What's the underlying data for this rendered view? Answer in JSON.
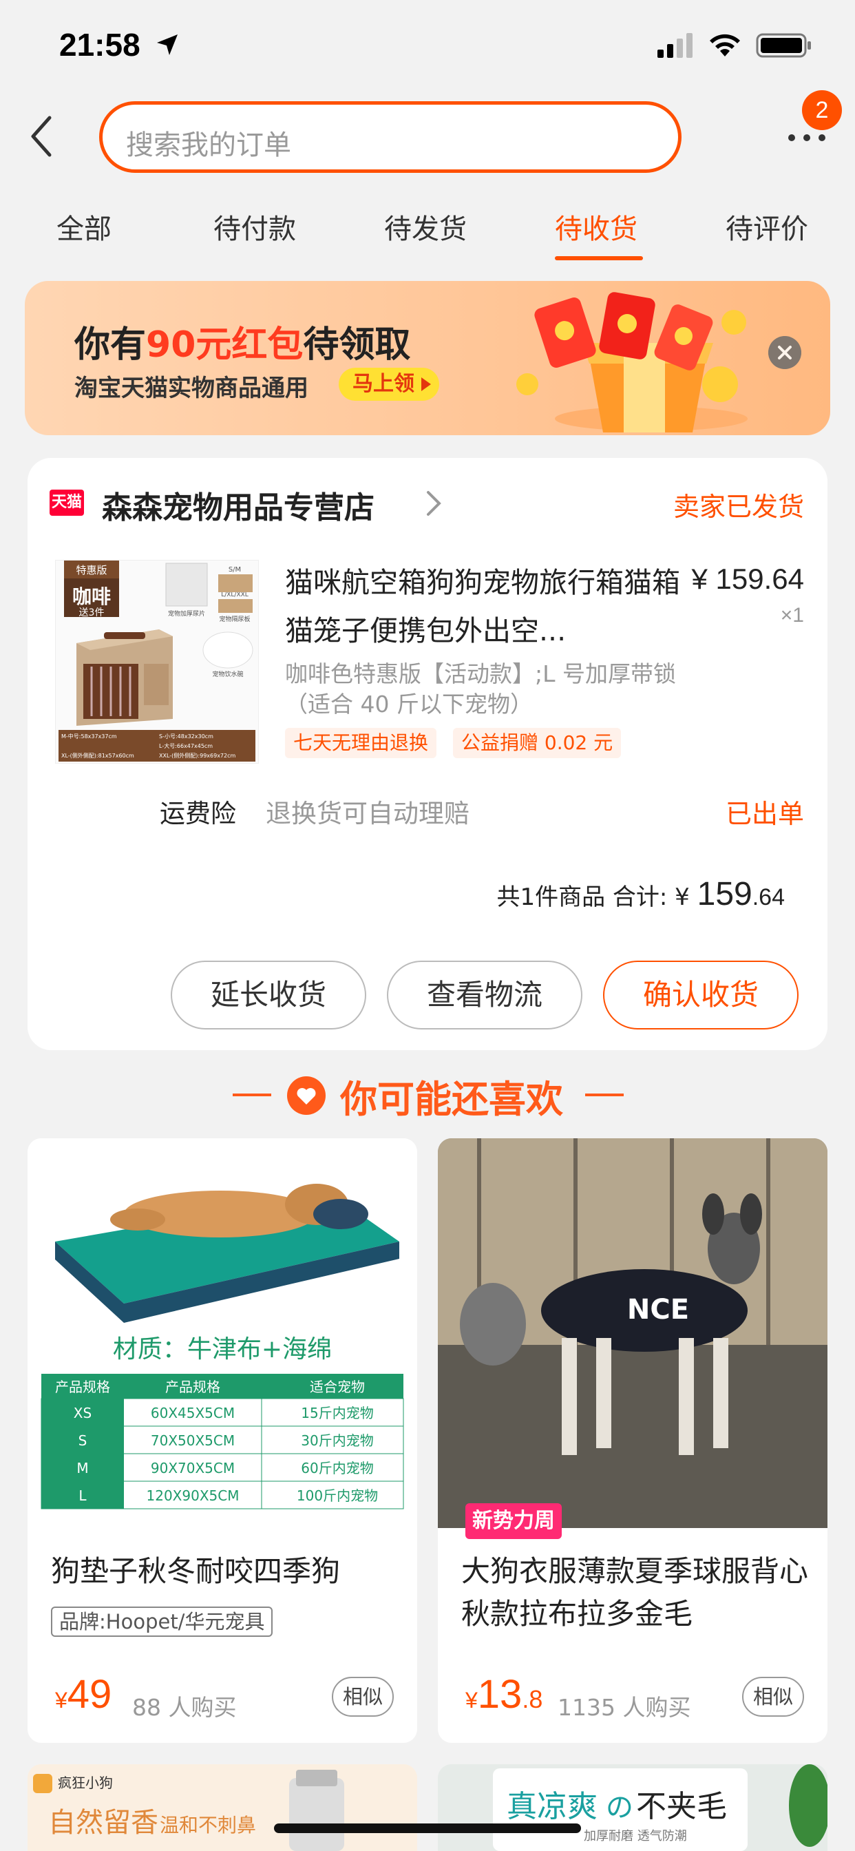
{
  "status_bar": {
    "time": "21:58"
  },
  "search": {
    "placeholder": "搜索我的订单",
    "badge_count": "2"
  },
  "tabs": [
    {
      "label": "全部",
      "active": false
    },
    {
      "label": "待付款",
      "active": false
    },
    {
      "label": "待发货",
      "active": false
    },
    {
      "label": "待收货",
      "active": true
    },
    {
      "label": "待评价",
      "active": false
    }
  ],
  "promo": {
    "title_prefix": "你有",
    "title_highlight": "90元红包",
    "title_suffix": "待领取",
    "subtitle": "淘宝天猫实物商品通用",
    "button": "马上领"
  },
  "order": {
    "platform_logo": "天猫",
    "shop_name": "森森宠物用品专营店",
    "status": "卖家已发货",
    "product_title": "猫咪航空箱狗狗宠物旅行箱猫箱猫笼子便携包外出空...",
    "price": "¥ 159.64",
    "quantity": "×1",
    "spec": "咖啡色特惠版【活动款】;L 号加厚带锁（适合 40 斤以下宠物）",
    "tags": [
      "七天无理由退换",
      "公益捐赠 0.02 元"
    ],
    "insurance_label": "运费险",
    "insurance_desc": "退换货可自动理赔",
    "insurance_status": "已出单",
    "total_prefix": "共1件商品  合计: ¥",
    "total_int": "159",
    "total_dec": ".64",
    "buttons": {
      "extend": "延长收货",
      "logistics": "查看物流",
      "confirm": "确认收货"
    },
    "image_text": {
      "edition": "特惠版",
      "color": "咖啡",
      "gift": "送3件",
      "size_chip_1": "S/M",
      "size_chip_2": "L/XL/XXL",
      "accessory_1": "宠物加厚尿片",
      "accessory_2": "宠物隔尿板",
      "accessory_3": "宠物饮水碗",
      "size_table": [
        "M-中号:58x37x37cm",
        "S-小号:48x32x30cm",
        "L-大号:66x47x45cm",
        "XL-(侧外侧配):81x57x60cm",
        "XXL-(侧外侧配):99x69x72cm"
      ]
    }
  },
  "recommend": {
    "title": "你可能还喜欢",
    "items": [
      {
        "name": "狗垫子秋冬耐咬四季狗",
        "brand": "品牌:Hoopet/华元宠具",
        "price_yen": "¥",
        "price_int": "49",
        "price_dec": "",
        "sold": "88 人购买",
        "similar": "相似",
        "image_caption": "材质：牛津布+海绵",
        "image_table_headers": [
          "产品规格",
          "产品规格",
          "适合宠物"
        ],
        "image_table_rows": [
          [
            "XS",
            "60X45X5CM",
            "15斤内宠物"
          ],
          [
            "S",
            "70X50X5CM",
            "30斤内宠物"
          ],
          [
            "M",
            "90X70X5CM",
            "60斤内宠物"
          ],
          [
            "L",
            "120X90X5CM",
            "100斤内宠物"
          ]
        ]
      },
      {
        "name": "大狗衣服薄款夏季球服背心秋款拉布拉多金毛",
        "tag": "新势力周",
        "price_yen": "¥",
        "price_int": "13",
        "price_dec": ".8",
        "sold": "1135 人购买",
        "similar": "相似",
        "jersey_text": "NCE"
      }
    ],
    "peek": [
      {
        "brand": "疯狂小狗",
        "text": "自然留香",
        "sub": "温和不刺鼻"
      },
      {
        "text_a": "真凉爽",
        "text_b": "の",
        "text_c": "不夹毛",
        "sub": "加厚耐磨   透气防潮"
      }
    ]
  },
  "colors": {
    "accent": "#ff5000",
    "tmall_red": "#ff0036",
    "hot_pink": "#ff2a73",
    "background": "#f2f2f2"
  }
}
